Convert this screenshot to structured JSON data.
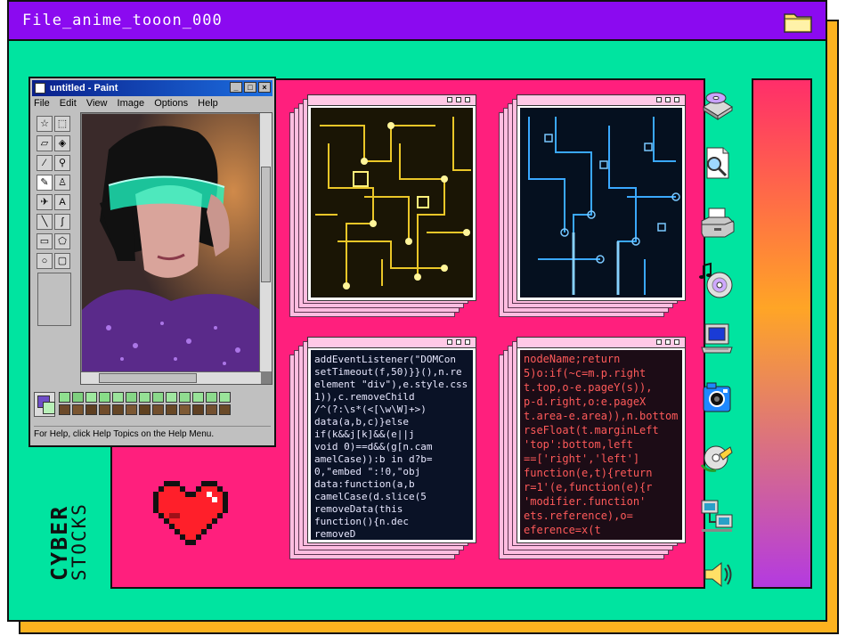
{
  "window": {
    "title": "File_anime_tooon_000"
  },
  "paint": {
    "title": "untitled - Paint",
    "menu": [
      "File",
      "Edit",
      "View",
      "Image",
      "Options",
      "Help"
    ],
    "status": "For Help, click Help Topics on the Help Menu."
  },
  "branding": {
    "line1": "CYBER",
    "line2": "STOCKS"
  },
  "colors": {
    "title_bar": "#8b0af0",
    "background": "#00e4a0",
    "panel": "#ff1f7d",
    "shadow": "#fcb21f",
    "stack_layer": "#ffbde0",
    "heart": "#ff1f2a"
  },
  "tiles": [
    {
      "name": "yellow-circuit-board",
      "glow": "#ffe23a",
      "bg": "#1a1505"
    },
    {
      "name": "blue-circuit-board",
      "glow": "#3aa8ff",
      "bg": "#05101f"
    },
    {
      "name": "code-screen-blue",
      "text_color": "#e8e8ff"
    },
    {
      "name": "code-screen-red",
      "text_color": "#ff5a5a"
    }
  ],
  "code_snippets": {
    "blue": [
      "addEventListener(\"DOMCon",
      "setTimeout(f,50)}}(),n.re",
      "element \"div\"),e.style.css",
      "1)),c.removeChild",
      "/^(?:\\s*(<[\\w\\W]+>)",
      "data(a,b,c)}else",
      "if(k&&j[k]&&(e||j",
      "void 0)==d&&(g[n.cam",
      "amelCase)):b in d?b=",
      "0,\"embed \":!0,\"obj",
      "data:function(a,b",
      "camelCase(d.slice(5",
      "removeData(this",
      "function(){n.dec",
      "removeD"
    ],
    "red": [
      "nodeName;return",
      "5)o:if(~c=m.p.right",
      "t.top,o-e.pageY(s)),",
      "p-d.right,o:e.pageX",
      "t.area-e.area)),n.bottom",
      "rseFloat(t.marginLeft",
      "'top':bottom,left",
      "==['right','left']",
      "function(e,t){return",
      "r=1'(e,function(e){r",
      "'modifier.function'",
      "ets.reference),o=",
      "eference=x(t"
    ]
  }
}
